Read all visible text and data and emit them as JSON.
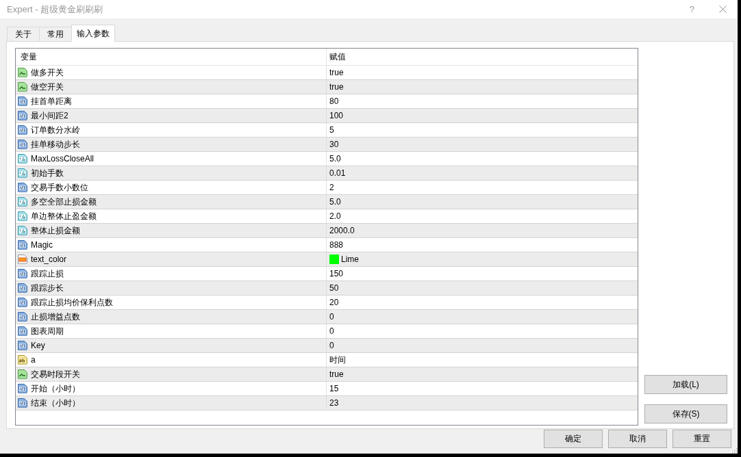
{
  "window": {
    "title": "Expert - 超级黄金刷刷刷",
    "help_button": "?"
  },
  "tabs": [
    {
      "label": "关于",
      "selected": false
    },
    {
      "label": "常用",
      "selected": false
    },
    {
      "label": "输入参数",
      "selected": true
    }
  ],
  "table": {
    "columns": [
      "变量",
      "赋值"
    ],
    "rows": [
      {
        "kind": "bool",
        "name": "做多开关",
        "value": "true"
      },
      {
        "kind": "bool",
        "name": "做空开关",
        "value": "true"
      },
      {
        "kind": "int",
        "name": "挂首单距离",
        "value": "80"
      },
      {
        "kind": "int",
        "name": "最小间距2",
        "value": "100"
      },
      {
        "kind": "int",
        "name": "订单数分水岭",
        "value": "5"
      },
      {
        "kind": "int",
        "name": "挂单移动步长",
        "value": "30"
      },
      {
        "kind": "double",
        "name": "MaxLossCloseAll",
        "value": "5.0"
      },
      {
        "kind": "double",
        "name": "初始手数",
        "value": "0.01"
      },
      {
        "kind": "int",
        "name": "交易手数小数位",
        "value": "2"
      },
      {
        "kind": "double",
        "name": "多空全部止损金额",
        "value": "5.0"
      },
      {
        "kind": "double",
        "name": "单边整体止盈金额",
        "value": "2.0"
      },
      {
        "kind": "double",
        "name": "整体止损金额",
        "value": "2000.0"
      },
      {
        "kind": "int",
        "name": "Magic",
        "value": "888"
      },
      {
        "kind": "color",
        "name": "text_color",
        "value": "Lime",
        "color": "#00ff00"
      },
      {
        "kind": "int",
        "name": "跟踪止损",
        "value": "150"
      },
      {
        "kind": "int",
        "name": "跟踪步长",
        "value": "50"
      },
      {
        "kind": "int",
        "name": "跟踪止损均价保利点数",
        "value": "20"
      },
      {
        "kind": "int",
        "name": "止损增益点数",
        "value": "0"
      },
      {
        "kind": "int",
        "name": "图表周期",
        "value": "0"
      },
      {
        "kind": "int",
        "name": "Key",
        "value": "0"
      },
      {
        "kind": "string",
        "name": "a",
        "value": "时间"
      },
      {
        "kind": "bool",
        "name": "交易时段开关",
        "value": "true"
      },
      {
        "kind": "int",
        "name": "开始（小时）",
        "value": "15"
      },
      {
        "kind": "int",
        "name": "结束（小时）",
        "value": "23"
      }
    ]
  },
  "side_buttons": [
    "加载(L)",
    "保存(S)"
  ],
  "footer_buttons": [
    "确定",
    "取消",
    "重置"
  ]
}
